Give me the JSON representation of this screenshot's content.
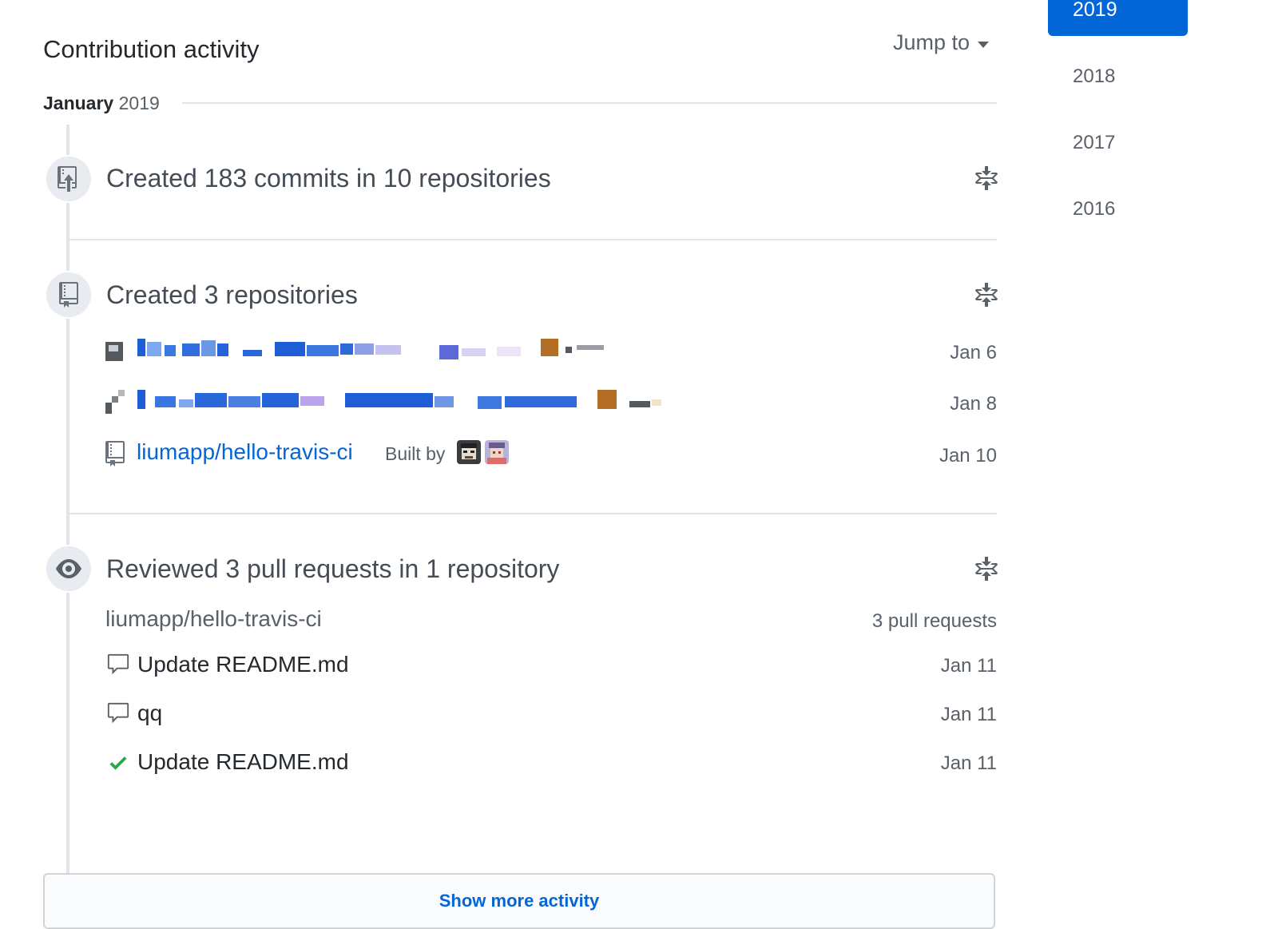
{
  "header": {
    "title": "Contribution activity",
    "jump_to_label": "Jump to"
  },
  "month": {
    "name": "January",
    "year": "2019"
  },
  "events": {
    "commits": {
      "title": "Created 183 commits in 10 repositories"
    },
    "repositories": {
      "title": "Created 3 repositories",
      "items": [
        {
          "name": "",
          "date": "Jan 6"
        },
        {
          "name": "",
          "date": "Jan 8"
        },
        {
          "name": "liumapp/hello-travis-ci",
          "built_by_label": "Built by",
          "date": "Jan 10"
        }
      ]
    },
    "reviews": {
      "title": "Reviewed 3 pull requests in 1 repository",
      "repo": "liumapp/hello-travis-ci",
      "count_label": "3 pull requests",
      "items": [
        {
          "title": "Update README.md",
          "date": "Jan 11",
          "status": "comment"
        },
        {
          "title": "qq",
          "date": "Jan 11",
          "status": "comment"
        },
        {
          "title": "Update README.md",
          "date": "Jan 11",
          "status": "approved"
        }
      ]
    }
  },
  "show_more_label": "Show more activity",
  "year_nav": {
    "active": "2019",
    "years": [
      "2018",
      "2017",
      "2016"
    ]
  },
  "colors": {
    "accent": "#0366d6",
    "approved": "#28a745",
    "muted": "#586069"
  },
  "icons": {
    "commits": "repo-push-icon",
    "repositories": "repo-icon",
    "reviews": "eye-icon",
    "fold": "fold-icon",
    "comment": "comment-icon",
    "approved": "check-icon"
  }
}
